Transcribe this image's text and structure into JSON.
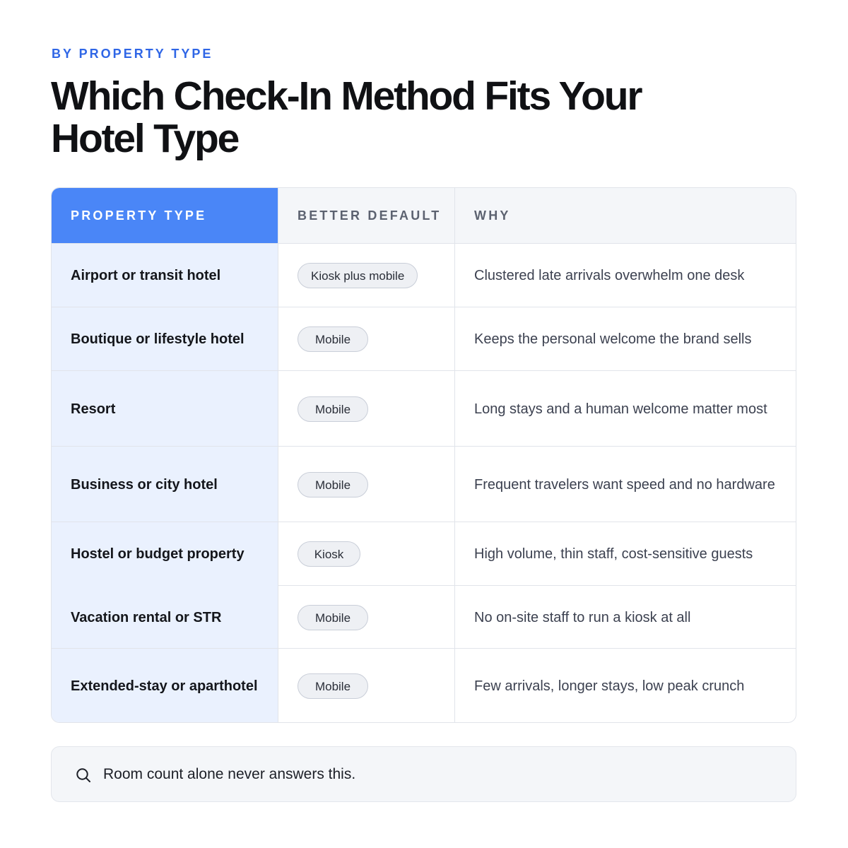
{
  "header": {
    "eyebrow": "BY PROPERTY TYPE",
    "title": "Which Check-In Method Fits Your Hotel Type"
  },
  "table": {
    "columns": [
      "PROPERTY TYPE",
      "BETTER DEFAULT",
      "WHY"
    ],
    "rows": [
      {
        "property": "Airport or transit hotel",
        "default": "Kiosk plus mobile",
        "why": "Clustered late arrivals overwhelm one desk"
      },
      {
        "property": "Boutique or lifestyle hotel",
        "default": "Mobile",
        "why": "Keeps the personal welcome the brand sells"
      },
      {
        "property": "Resort",
        "default": "Mobile",
        "why": "Long stays and a human welcome matter most"
      },
      {
        "property": "Business or city hotel",
        "default": "Mobile",
        "why": "Frequent travelers want speed and no hardware"
      },
      {
        "property": "Hostel or budget property",
        "default": "Kiosk",
        "why": "High volume, thin staff, cost-sensitive guests"
      },
      {
        "property": "Vacation rental or STR",
        "default": "Mobile",
        "why": "No on-site staff to run a kiosk at all"
      },
      {
        "property": "Extended-stay or aparthotel",
        "default": "Mobile",
        "why": "Few arrivals, longer stays, low peak crunch"
      }
    ]
  },
  "note": {
    "icon": "search-icon",
    "text": "Room count alone never answers this."
  },
  "colors": {
    "accent": "#2f66e6",
    "header_highlight": "#4a86f7",
    "first_column_bg": "#eaf1fe"
  }
}
